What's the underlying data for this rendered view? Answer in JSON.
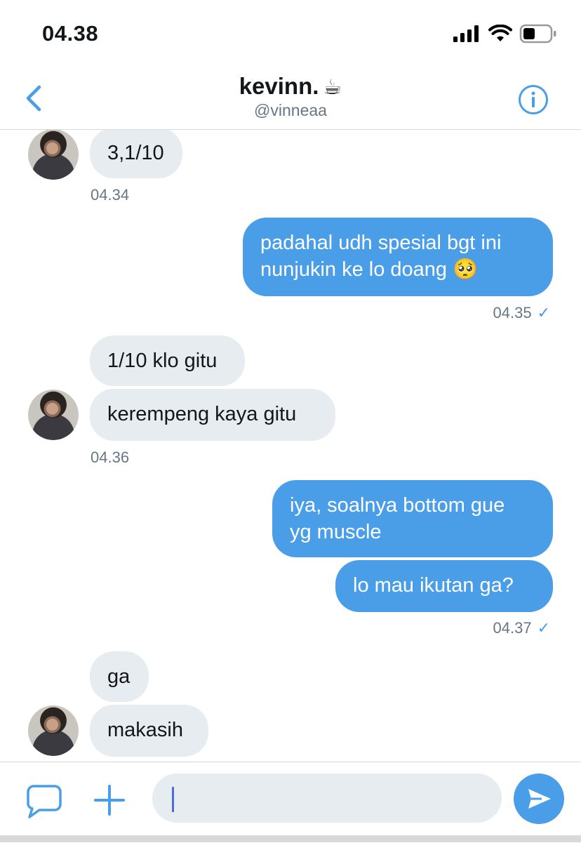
{
  "status": {
    "time": "04.38"
  },
  "header": {
    "name": "kevinn.",
    "name_emoji": "☕",
    "handle": "@vinneaa"
  },
  "messages": [
    {
      "dir": "in",
      "text": "3,1/10"
    },
    {
      "dir": "in",
      "time": "04.34"
    },
    {
      "dir": "out",
      "text": "padahal udh spesial bgt ini\nnunjukin ke lo doang 🥺"
    },
    {
      "dir": "out",
      "time": "04.35",
      "read": "✓"
    },
    {
      "dir": "in",
      "text": "1/10 klo gitu"
    },
    {
      "dir": "in",
      "text": "kerempeng kaya gitu"
    },
    {
      "dir": "in",
      "time": "04.36"
    },
    {
      "dir": "out",
      "text": "iya, soalnya bottom gue\nyg muscle"
    },
    {
      "dir": "out",
      "text": "lo mau ikutan ga?"
    },
    {
      "dir": "out",
      "time": "04.37",
      "read": "✓"
    },
    {
      "dir": "in",
      "text": "ga"
    },
    {
      "dir": "in",
      "text": "makasih"
    }
  ],
  "composer": {
    "input_value": ""
  },
  "icons": {
    "back": "chevron-left-icon",
    "info": "info-icon",
    "gif": "message-bubble-icon",
    "add": "plus-icon",
    "send": "send-icon"
  },
  "colors": {
    "accent": "#4a9ee8",
    "incoming_bubble": "#e6ecf0",
    "muted": "#657786"
  }
}
